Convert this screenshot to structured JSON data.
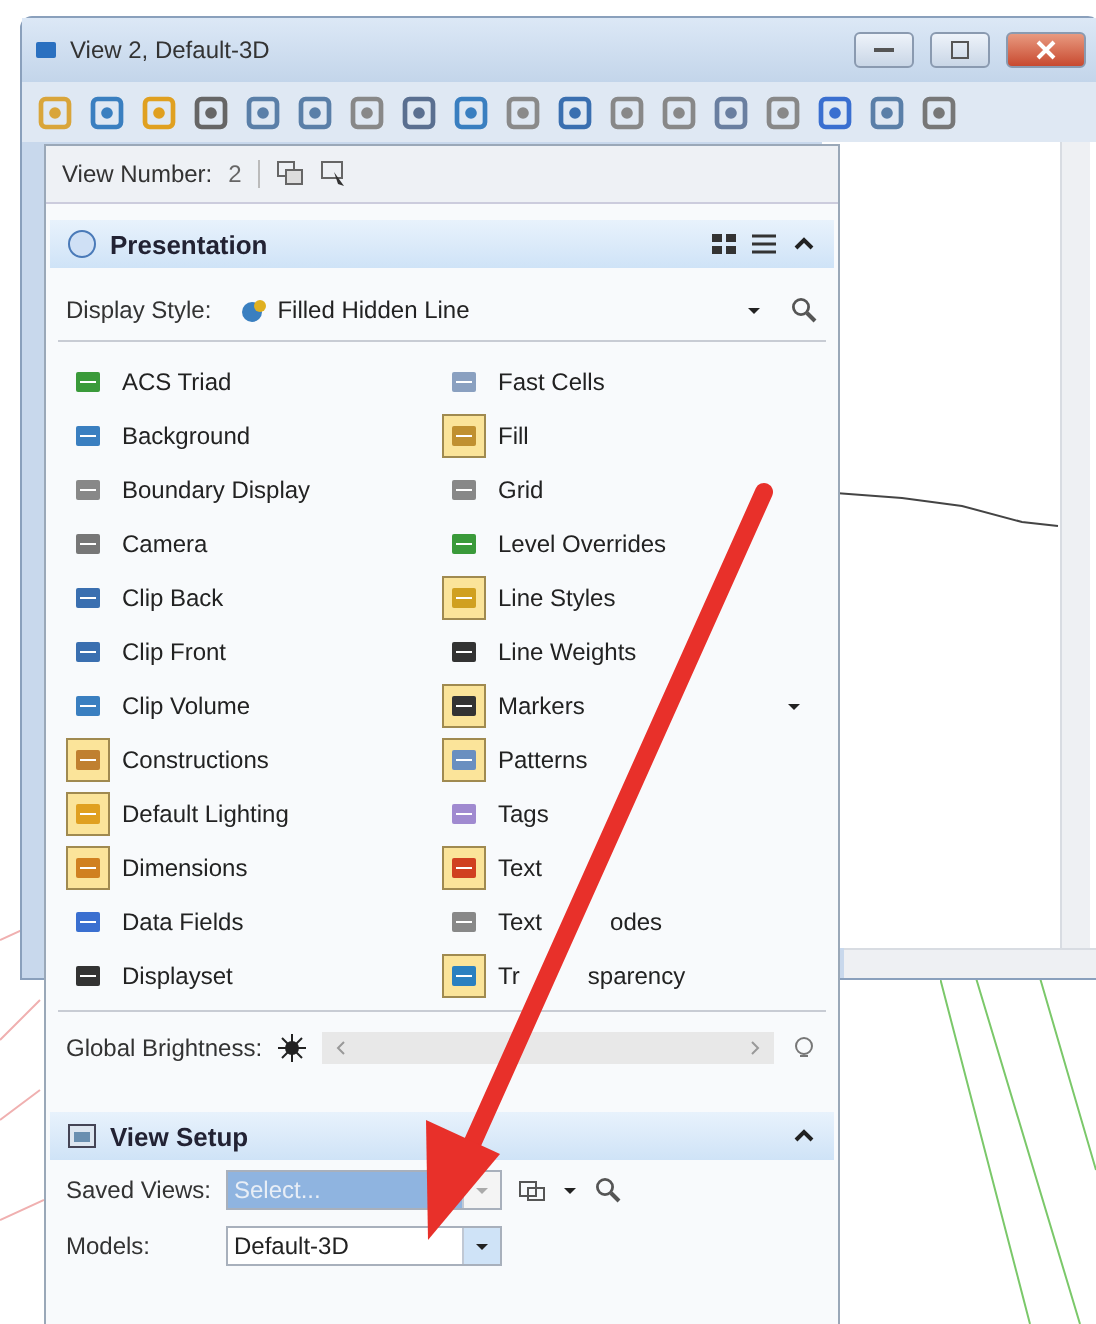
{
  "window": {
    "title": "View 2, Default-3D"
  },
  "view_number": {
    "label": "View Number:",
    "value": "2"
  },
  "presentation": {
    "title": "Presentation",
    "expanded": true,
    "display_style": {
      "label": "Display Style:",
      "value": "Filled Hidden Line"
    },
    "left_items": [
      {
        "label": "ACS Triad",
        "on": false
      },
      {
        "label": "Background",
        "on": false
      },
      {
        "label": "Boundary Display",
        "on": false
      },
      {
        "label": "Camera",
        "on": false
      },
      {
        "label": "Clip Back",
        "on": false
      },
      {
        "label": "Clip Front",
        "on": false
      },
      {
        "label": "Clip Volume",
        "on": false
      },
      {
        "label": "Constructions",
        "on": true
      },
      {
        "label": "Default Lighting",
        "on": true
      },
      {
        "label": "Dimensions",
        "on": true
      },
      {
        "label": "Data Fields",
        "on": false
      },
      {
        "label": "Displayset",
        "on": false
      }
    ],
    "right_items": [
      {
        "label": "Fast Cells",
        "on": false
      },
      {
        "label": "Fill",
        "on": true
      },
      {
        "label": "Grid",
        "on": false
      },
      {
        "label": "Level Overrides",
        "on": false
      },
      {
        "label": "Line Styles",
        "on": true
      },
      {
        "label": "Line Weights",
        "on": false
      },
      {
        "label": "Markers",
        "on": true
      },
      {
        "label": "Patterns",
        "on": true
      },
      {
        "label": "Tags",
        "on": false
      },
      {
        "label": "Text",
        "on": true
      },
      {
        "label": "Text",
        "label_after": "odes",
        "on": false
      },
      {
        "label": "Tr",
        "label_after": "sparency",
        "on": true
      }
    ],
    "global_brightness": {
      "label": "Global Brightness:"
    }
  },
  "view_setup": {
    "title": "View Setup",
    "expanded": true,
    "saved_views": {
      "label": "Saved Views:",
      "value": "Select..."
    },
    "models": {
      "label": "Models:",
      "value": "Default-3D"
    }
  }
}
